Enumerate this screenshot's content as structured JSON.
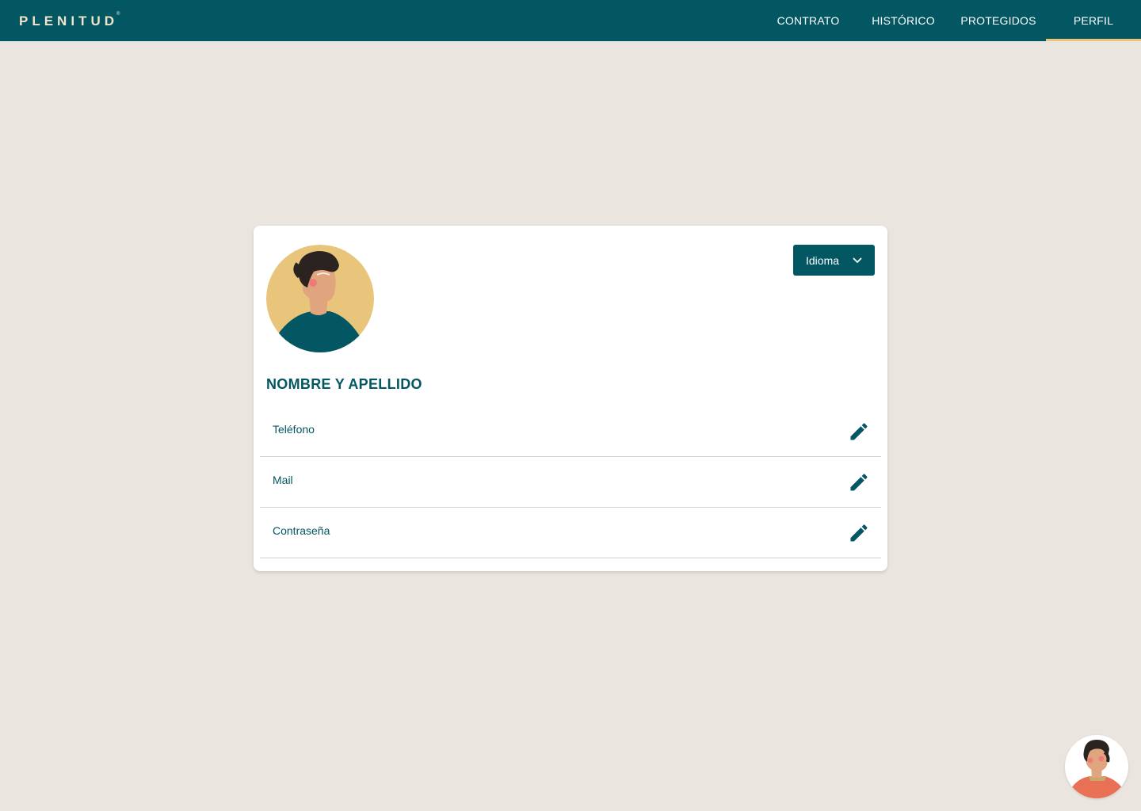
{
  "brand": {
    "logo_text": "PLENITUD",
    "registered_mark": "®"
  },
  "nav": {
    "items": [
      {
        "label": "CONTRATO",
        "active": false
      },
      {
        "label": "HISTÓRICO",
        "active": false
      },
      {
        "label": "PROTEGIDOS",
        "active": false
      },
      {
        "label": "PERFIL",
        "active": true
      }
    ]
  },
  "profile": {
    "language_button": "Idioma",
    "name": "NOMBRE Y APELLIDO",
    "fields": [
      {
        "label": "Teléfono",
        "icon": "pencil-icon"
      },
      {
        "label": "Mail",
        "icon": "pencil-icon"
      },
      {
        "label": "Contraseña",
        "icon": "pencil-icon"
      }
    ]
  },
  "colors": {
    "primary": "#035762",
    "accent": "#E8C57A",
    "background": "#EAE5DF",
    "avatar_bg": "#E8C57A"
  }
}
